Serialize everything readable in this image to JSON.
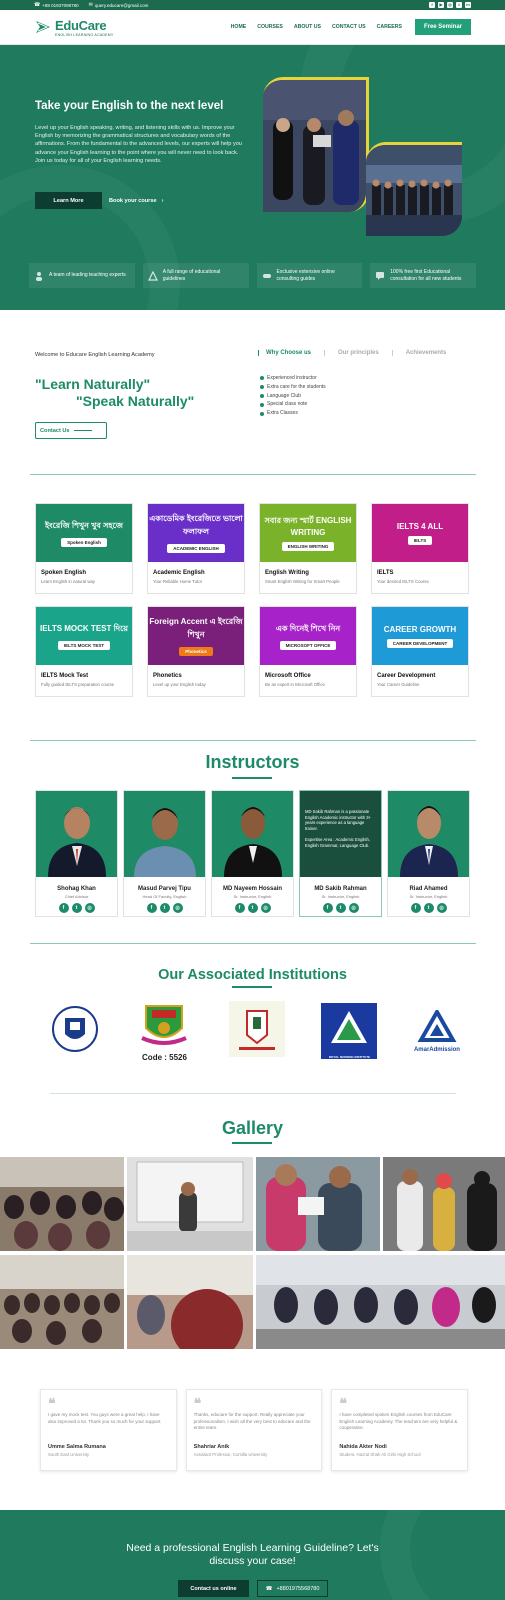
{
  "topbar": {
    "phone": "+88 01937098780",
    "email": "query.educare@gmail.com"
  },
  "logo": {
    "name": "EduCare",
    "tagline": "ENGLISH LEARNING ACADEMY"
  },
  "nav": {
    "items": [
      "HOME",
      "COURSES",
      "ABOUT US",
      "CONTACT US",
      "CAREERS"
    ],
    "cta": "Free Seminar"
  },
  "hero": {
    "title": "Take your English to the next level",
    "text": "Level up your English speaking, writing, and listening skills with us. Improve your English by memorizing the grammatical structures and vocabulary words of the affirmations. From the fundamental to the advanced levels, our experts will help you advance your English learning to the point where you will never need to look back. Join us today for all of your English learning needs.",
    "learn_more": "Learn More",
    "book": "Book your course",
    "features": [
      "A team of leading teaching experts",
      "A full range of educational guidelines",
      "Exclusive extensive online consulting guides",
      "100% free first Educational consultation for all new students"
    ]
  },
  "about": {
    "welcome": "Welcome to Educare English Learning Academy",
    "tabs": [
      "Why Choose us",
      "Our principles",
      "Achievements"
    ],
    "quote1": "\"Learn Naturally\"",
    "quote2": "\"Speak Naturally\"",
    "contact": "Contact Us",
    "checks": [
      "Experienced instructor",
      "Extra care for the students",
      "Language Club",
      "Special class note",
      "Extra Classes"
    ]
  },
  "courses": [
    {
      "title": "Spoken English",
      "sub": "Learn English in natural way",
      "img_text": "ইংরেজি শিখুন খুব সহজে",
      "tag": "Spoken English",
      "color": "#1f8a66"
    },
    {
      "title": "Academic English",
      "sub": "Your Reliable Home Tutor",
      "img_text": "একাডেমিক ইংরেজিতে ভালো ফলাফল",
      "tag": "ACADEMIC ENGLISH",
      "color": "#6a2ec9"
    },
    {
      "title": "English Writing",
      "sub": "Smart English Writing for Smart People",
      "img_text": "সবার জন্য স্মার্ট ENGLISH WRITING",
      "tag": "ENGLISH WRITING",
      "color": "#7ab32a"
    },
    {
      "title": "IELTS",
      "sub": "Your desired IELTS Course",
      "img_text": "IELTS 4 ALL",
      "tag": "IELTS",
      "color": "#c21e8a"
    },
    {
      "title": "IELTS Mock Test",
      "sub": "Fully guided IELTS preparation course",
      "img_text": "IELTS MOCK TEST দিয়ে",
      "tag": "IELTS MOCK TEST",
      "color": "#1aa58a"
    },
    {
      "title": "Phonetics",
      "sub": "Level up your English today",
      "img_text": "Foreign Accent এ ইংরেজি শিখুন",
      "tag": "Phonetics",
      "color": "#7a1f7a"
    },
    {
      "title": "Microsoft Office",
      "sub": "Be an expert in Microsoft Office",
      "img_text": "এক দিনেই শিখে নিন",
      "tag": "MICROSOFT OFFICE",
      "color": "#a822c9"
    },
    {
      "title": "Career Development",
      "sub": "Your Career Guideline",
      "img_text": "CAREER GROWTH",
      "tag": "CAREER DEVELOPMENT",
      "color": "#1e9ad6"
    }
  ],
  "instructors": {
    "title": "Instructors",
    "people": [
      {
        "name": "Shohag Khan",
        "role": "Chief Advisor"
      },
      {
        "name": "Masud Parvej Tipu",
        "role": "Head Of Faculty, English"
      },
      {
        "name": "MD Nayeem Hossain",
        "role": "Sr. Instructor, English"
      },
      {
        "name": "MD Sakib Rahman",
        "role": "Sr. Instructor, English",
        "bio": "MD Sakib Rahman is a passionate English Academic instructor with 3+ years experience as a language trainer.",
        "expertise": "Expertise Area : Academic English, English Grammar, Language Club."
      },
      {
        "name": "Riad Ahamed",
        "role": "Sr. Instructor, English"
      }
    ]
  },
  "institutions": {
    "title": "Our Associated Institutions",
    "code": "Code : 5526",
    "rni": "ROYAL NURSING INSTITUTE",
    "amar": "AmarAdmission"
  },
  "gallery": {
    "title": "Gallery"
  },
  "testimonials": [
    {
      "text": "I gave my mock test. You guys were a great help. I have also improved a lot. Thank you so much for your support.",
      "name": "Umme Salma Rumana",
      "role": "South East University"
    },
    {
      "text": "Thanks, educare for the support. Really appreciate your professionalism. I wish all the very best to educare and the entire team.",
      "name": "Shahriar Anik",
      "role": "Assistant Professor, Comilla University"
    },
    {
      "text": "I have completed spoken English courses from EduCare English Learning Academy. The teachers are very helpful & cooperative.",
      "name": "Nahida Akter Nodi",
      "role": "Student, Hazrat Shah Ali Girls High School"
    }
  ],
  "cta": {
    "line1": "Need a professional English Learning Guideline? Let's",
    "line2": "discuss your case!",
    "contact": "Contact us online",
    "phone": "+8801975568780"
  }
}
